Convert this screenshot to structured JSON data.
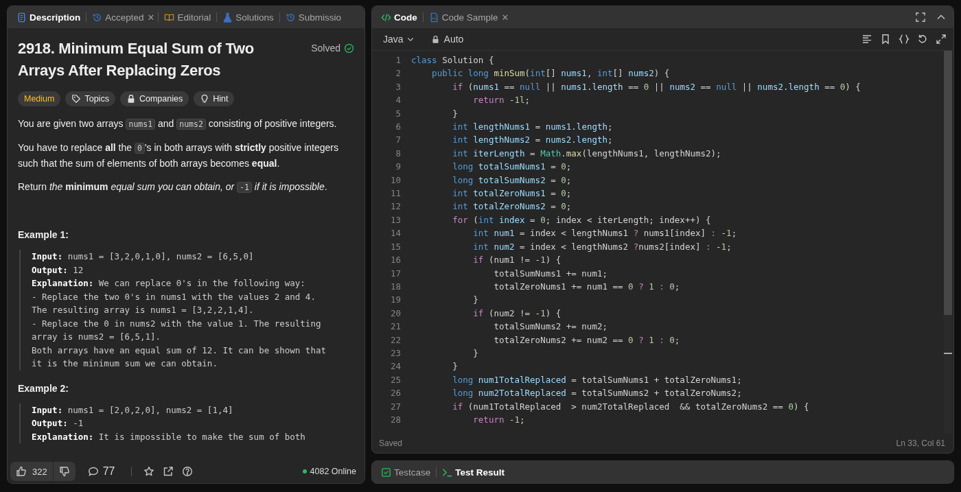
{
  "left_panel": {
    "tabs": [
      {
        "label": "Description",
        "selected": true
      },
      {
        "label": "Accepted",
        "selected": false,
        "close_mark": "✕"
      },
      {
        "label": "Editorial",
        "selected": false
      },
      {
        "label": "Solutions",
        "selected": false
      },
      {
        "label": "Submissio",
        "selected": false
      }
    ],
    "problem": {
      "title": "2918. Minimum Equal Sum of Two Arrays After Replacing Zeros",
      "status": "Solved",
      "difficulty": "Medium",
      "chips": [
        {
          "label": "Topics"
        },
        {
          "label": "Companies"
        },
        {
          "label": "Hint"
        }
      ],
      "paragraphs": [
        [
          {
            "kind": "text",
            "text": "You are given two arrays "
          },
          {
            "kind": "code",
            "text": "nums1"
          },
          {
            "kind": "text",
            "text": " and "
          },
          {
            "kind": "code",
            "text": "nums2"
          },
          {
            "kind": "text",
            "text": " consisting of positive integers."
          }
        ],
        [
          {
            "kind": "text",
            "text": "You have to replace **all** the "
          },
          {
            "kind": "code",
            "text": "0"
          },
          {
            "kind": "text",
            "text": "'s in both arrays with **strictly** positive integers such that the sum of elements of both arrays becomes **equal**."
          }
        ],
        [
          {
            "kind": "text",
            "text": "Return *the* **minimum** *equal sum you can obtain, or* "
          },
          {
            "kind": "code",
            "text": "-1"
          },
          {
            "kind": "text",
            "text": " *if it is impossible*."
          }
        ]
      ],
      "examples": [
        {
          "title": "Example 1:",
          "lines": [
            {
              "label": "Input:",
              "text": " nums1 = [3,2,0,1,0], nums2 = [6,5,0]"
            },
            {
              "label": "Output:",
              "text": " 12"
            },
            {
              "label": "Explanation:",
              "text": " We can replace 0's in the following way:"
            },
            {
              "text": "- Replace the two 0's in nums1 with the values 2 and 4. The resulting array is nums1 = [3,2,2,1,4]."
            },
            {
              "text": "- Replace the 0 in nums2 with the value 1. The resulting array is nums2 = [6,5,1]."
            },
            {
              "text": "Both arrays have an equal sum of 12. It can be shown that it is the minimum sum we can obtain."
            }
          ]
        },
        {
          "title": "Example 2:",
          "lines": [
            {
              "label": "Input:",
              "text": " nums1 = [2,0,2,0], nums2 = [1,4]"
            },
            {
              "label": "Output:",
              "text": " -1"
            },
            {
              "label": "Explanation:",
              "text": " It is impossible to make the sum of both"
            }
          ]
        }
      ]
    },
    "footer": {
      "likes": "322",
      "comments": "77",
      "online": "4082 Online"
    }
  },
  "code_panel": {
    "tabs": [
      {
        "label": "Code",
        "selected": true
      },
      {
        "label": "Code Sample",
        "selected": false,
        "close_mark": "✕"
      }
    ],
    "language": "Java",
    "mode": "Auto",
    "lines": [
      {
        "n": "1",
        "t": [
          {
            "kind": "kw",
            "text": "class"
          },
          {
            "kind": "p",
            "text": " Solution {"
          }
        ]
      },
      {
        "n": "2",
        "t": [
          {
            "kind": "kw",
            "text": "    public long"
          },
          {
            "kind": "fn",
            "text": " minSum"
          },
          {
            "kind": "p",
            "text": "("
          },
          {
            "kind": "kw",
            "text": "int"
          },
          {
            "kind": "p",
            "text": "[] "
          },
          {
            "kind": "var",
            "text": "nums1"
          },
          {
            "kind": "p",
            "text": ", "
          },
          {
            "kind": "kw",
            "text": "int"
          },
          {
            "kind": "p",
            "text": "[] "
          },
          {
            "kind": "var",
            "text": "nums2"
          },
          {
            "kind": "p",
            "text": ") {"
          }
        ]
      },
      {
        "n": "3",
        "t": [
          {
            "kind": "ctl",
            "text": "        if"
          },
          {
            "kind": "p",
            "text": " ("
          },
          {
            "kind": "var",
            "text": "nums1"
          },
          {
            "kind": "p",
            "text": " == "
          },
          {
            "kind": "kw",
            "text": "null"
          },
          {
            "kind": "p",
            "text": " || "
          },
          {
            "kind": "var",
            "text": "nums1"
          },
          {
            "kind": "p",
            "text": "."
          },
          {
            "kind": "var",
            "text": "length"
          },
          {
            "kind": "p",
            "text": " == "
          },
          {
            "kind": "num",
            "text": "0"
          },
          {
            "kind": "p",
            "text": " || "
          },
          {
            "kind": "var",
            "text": "nums2"
          },
          {
            "kind": "p",
            "text": " == "
          },
          {
            "kind": "kw",
            "text": "null"
          },
          {
            "kind": "p",
            "text": " || "
          },
          {
            "kind": "var",
            "text": "nums2"
          },
          {
            "kind": "p",
            "text": "."
          },
          {
            "kind": "var",
            "text": "length"
          },
          {
            "kind": "p",
            "text": " == "
          },
          {
            "kind": "num",
            "text": "0"
          },
          {
            "kind": "p",
            "text": ") {"
          }
        ]
      },
      {
        "n": "4",
        "t": [
          {
            "kind": "ctl",
            "text": "            return"
          },
          {
            "kind": "p",
            "text": " -"
          },
          {
            "kind": "num",
            "text": "1l"
          },
          {
            "kind": "p",
            "text": ";"
          }
        ]
      },
      {
        "n": "5",
        "t": [
          {
            "kind": "p",
            "text": "        }"
          }
        ]
      },
      {
        "n": "6",
        "t": [
          {
            "kind": "kw",
            "text": "        int"
          },
          {
            "kind": "var",
            "text": " lengthNums1"
          },
          {
            "kind": "p",
            "text": " = "
          },
          {
            "kind": "var",
            "text": "nums1"
          },
          {
            "kind": "p",
            "text": "."
          },
          {
            "kind": "var",
            "text": "length"
          },
          {
            "kind": "p",
            "text": ";"
          }
        ]
      },
      {
        "n": "7",
        "t": [
          {
            "kind": "kw",
            "text": "        int"
          },
          {
            "kind": "var",
            "text": " lengthNums2"
          },
          {
            "kind": "p",
            "text": " = "
          },
          {
            "kind": "var",
            "text": "nums2"
          },
          {
            "kind": "p",
            "text": "."
          },
          {
            "kind": "var",
            "text": "length"
          },
          {
            "kind": "p",
            "text": ";"
          }
        ]
      },
      {
        "n": "8",
        "t": [
          {
            "kind": "kw",
            "text": "        int"
          },
          {
            "kind": "var",
            "text": " iterLength"
          },
          {
            "kind": "p",
            "text": " = "
          },
          {
            "kind": "cls",
            "text": "Math"
          },
          {
            "kind": "p",
            "text": "."
          },
          {
            "kind": "fn",
            "text": "max"
          },
          {
            "kind": "p",
            "text": "(lengthNums1, lengthNums2);"
          }
        ]
      },
      {
        "n": "9",
        "t": [
          {
            "kind": "kw",
            "text": "        long"
          },
          {
            "kind": "var",
            "text": " totalSumNums1"
          },
          {
            "kind": "p",
            "text": " = "
          },
          {
            "kind": "num",
            "text": "0"
          },
          {
            "kind": "p",
            "text": ";"
          }
        ]
      },
      {
        "n": "10",
        "t": [
          {
            "kind": "kw",
            "text": "        long"
          },
          {
            "kind": "var",
            "text": " totalSumNums2"
          },
          {
            "kind": "p",
            "text": " = "
          },
          {
            "kind": "num",
            "text": "0"
          },
          {
            "kind": "p",
            "text": ";"
          }
        ]
      },
      {
        "n": "11",
        "t": [
          {
            "kind": "kw",
            "text": "        int"
          },
          {
            "kind": "var",
            "text": " totalZeroNums1"
          },
          {
            "kind": "p",
            "text": " = "
          },
          {
            "kind": "num",
            "text": "0"
          },
          {
            "kind": "p",
            "text": ";"
          }
        ]
      },
      {
        "n": "12",
        "t": [
          {
            "kind": "kw",
            "text": "        int"
          },
          {
            "kind": "var",
            "text": " totalZeroNums2"
          },
          {
            "kind": "p",
            "text": " = "
          },
          {
            "kind": "num",
            "text": "0"
          },
          {
            "kind": "p",
            "text": ";"
          }
        ]
      },
      {
        "n": "13",
        "t": [
          {
            "kind": "ctl",
            "text": "        for"
          },
          {
            "kind": "p",
            "text": " ("
          },
          {
            "kind": "kw",
            "text": "int"
          },
          {
            "kind": "var",
            "text": " index"
          },
          {
            "kind": "p",
            "text": " = "
          },
          {
            "kind": "num",
            "text": "0"
          },
          {
            "kind": "p",
            "text": "; index < iterLength; index++) {"
          }
        ]
      },
      {
        "n": "14",
        "t": [
          {
            "kind": "kw",
            "text": "            int"
          },
          {
            "kind": "var",
            "text": " num1"
          },
          {
            "kind": "p",
            "text": " = index < lengthNums1 "
          },
          {
            "kind": "ctl",
            "text": "?"
          },
          {
            "kind": "p",
            "text": " nums1[index] "
          },
          {
            "kind": "ctl",
            "text": ":"
          },
          {
            "kind": "p",
            "text": " -"
          },
          {
            "kind": "num",
            "text": "1"
          },
          {
            "kind": "p",
            "text": ";"
          }
        ]
      },
      {
        "n": "15",
        "t": [
          {
            "kind": "kw",
            "text": "            int"
          },
          {
            "kind": "var",
            "text": " num2"
          },
          {
            "kind": "p",
            "text": " = index < lengthNums2 "
          },
          {
            "kind": "ctl",
            "text": "?"
          },
          {
            "kind": "p",
            "text": "nums2[index] "
          },
          {
            "kind": "ctl",
            "text": ":"
          },
          {
            "kind": "p",
            "text": " -"
          },
          {
            "kind": "num",
            "text": "1"
          },
          {
            "kind": "p",
            "text": ";"
          }
        ]
      },
      {
        "n": "16",
        "t": [
          {
            "kind": "ctl",
            "text": "            if"
          },
          {
            "kind": "p",
            "text": " (num1 != -"
          },
          {
            "kind": "num",
            "text": "1"
          },
          {
            "kind": "p",
            "text": ") {"
          }
        ]
      },
      {
        "n": "17",
        "t": [
          {
            "kind": "p",
            "text": "                totalSumNums1 += num1;"
          }
        ]
      },
      {
        "n": "18",
        "t": [
          {
            "kind": "p",
            "text": "                totalZeroNums1 += num1 == "
          },
          {
            "kind": "num",
            "text": "0"
          },
          {
            "kind": "ctl",
            "text": " ?"
          },
          {
            "kind": "num",
            "text": " 1"
          },
          {
            "kind": "ctl",
            "text": " :"
          },
          {
            "kind": "num",
            "text": " 0"
          },
          {
            "kind": "p",
            "text": ";"
          }
        ]
      },
      {
        "n": "19",
        "t": [
          {
            "kind": "p",
            "text": "            }"
          }
        ]
      },
      {
        "n": "20",
        "t": [
          {
            "kind": "ctl",
            "text": "            if"
          },
          {
            "kind": "p",
            "text": " (num2 != -"
          },
          {
            "kind": "num",
            "text": "1"
          },
          {
            "kind": "p",
            "text": ") {"
          }
        ]
      },
      {
        "n": "21",
        "t": [
          {
            "kind": "p",
            "text": "                totalSumNums2 += num2;"
          }
        ]
      },
      {
        "n": "22",
        "t": [
          {
            "kind": "p",
            "text": "                totalZeroNums2 += num2 == "
          },
          {
            "kind": "num",
            "text": "0"
          },
          {
            "kind": "ctl",
            "text": " ?"
          },
          {
            "kind": "num",
            "text": " 1"
          },
          {
            "kind": "ctl",
            "text": " :"
          },
          {
            "kind": "num",
            "text": " 0"
          },
          {
            "kind": "p",
            "text": ";"
          }
        ]
      },
      {
        "n": "23",
        "t": [
          {
            "kind": "p",
            "text": "            }"
          }
        ]
      },
      {
        "n": "24",
        "t": [
          {
            "kind": "p",
            "text": "        }"
          }
        ]
      },
      {
        "n": "25",
        "t": [
          {
            "kind": "kw",
            "text": "        long"
          },
          {
            "kind": "var",
            "text": " num1TotalReplaced"
          },
          {
            "kind": "p",
            "text": " = totalSumNums1 + totalZeroNums1;"
          }
        ]
      },
      {
        "n": "26",
        "t": [
          {
            "kind": "kw",
            "text": "        long"
          },
          {
            "kind": "var",
            "text": " num2TotalReplaced"
          },
          {
            "kind": "p",
            "text": " = totalSumNums2 + totalZeroNums2;"
          }
        ]
      },
      {
        "n": "27",
        "t": [
          {
            "kind": "ctl",
            "text": "        if"
          },
          {
            "kind": "p",
            "text": " (num1TotalReplaced  > num2TotalReplaced  && totalZeroNums2 == "
          },
          {
            "kind": "num",
            "text": "0"
          },
          {
            "kind": "p",
            "text": ") {"
          }
        ]
      },
      {
        "n": "28",
        "t": [
          {
            "kind": "ctl",
            "text": "            return"
          },
          {
            "kind": "p",
            "text": " -"
          },
          {
            "kind": "num",
            "text": "1"
          },
          {
            "kind": "p",
            "text": ";"
          }
        ]
      }
    ],
    "save_status": "Saved",
    "cursor": "Ln 33, Col 61"
  },
  "result_panel": {
    "tabs": [
      {
        "label": "Testcase",
        "selected": false
      },
      {
        "label": "Test Result",
        "selected": true
      }
    ]
  }
}
